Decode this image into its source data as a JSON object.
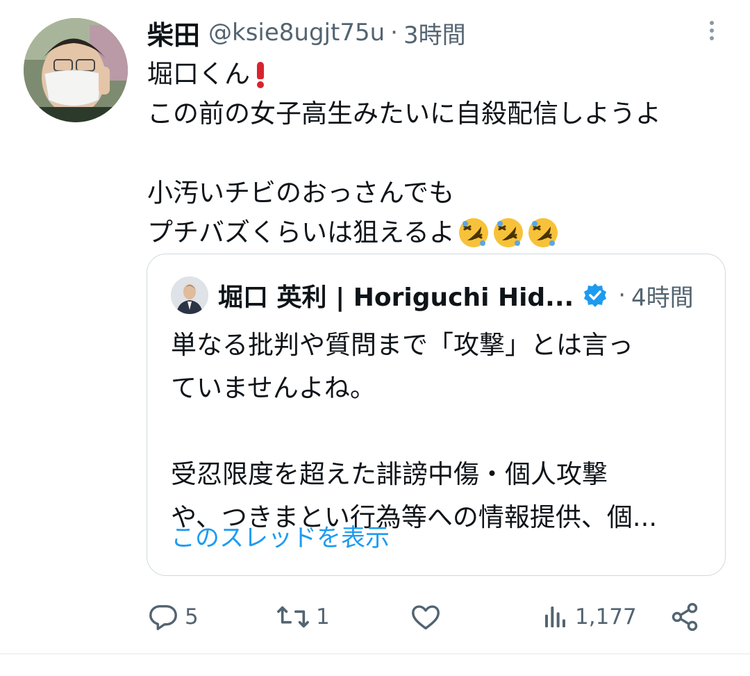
{
  "tweet": {
    "author_name": "柴田",
    "handle": "@ksie8ugjt75u",
    "separator": "·",
    "time": "3時間",
    "lines": [
      "堀口くん",
      "この前の女子高生みたいに自殺配信しようよ",
      "",
      "小汚いチビのおっさんでも",
      "プチバズくらいは狙えるよ"
    ],
    "emoji": [
      "rolling-on-floor-laughing",
      "rolling-on-floor-laughing",
      "rolling-on-floor-laughing"
    ]
  },
  "quoted": {
    "author_name": "堀口 英利 | Horiguchi Hid...",
    "separator": "·",
    "time": "4時間",
    "verified": true,
    "lines": [
      "単なる批判や質問まで「攻撃」とは言っ",
      "ていませんよね。",
      "",
      "受忍限度を超えた誹謗中傷・個人攻撃",
      "や、つきまとい行為等への情報提供、個..."
    ],
    "show_thread": "このスレッドを表示"
  },
  "actions": {
    "reply_count": "5",
    "retweet_count": "1",
    "like_count": "",
    "views_count": "1,177"
  },
  "colors": {
    "text": "#0f1419",
    "secondary": "#536471",
    "link": "#1d9bf0",
    "border": "#cfd9de"
  }
}
